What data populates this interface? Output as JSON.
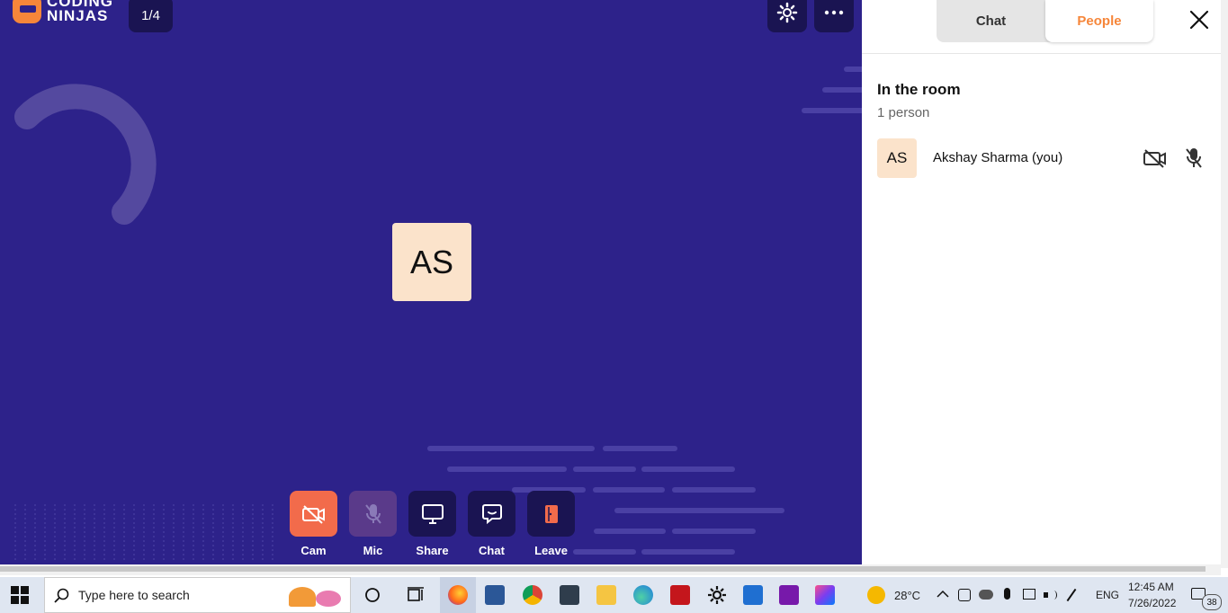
{
  "app": {
    "logo_text_line1": "CODING",
    "logo_text_line2": "NINJAS",
    "page_counter": "1/4"
  },
  "stage": {
    "avatar_initials": "AS"
  },
  "controls": [
    {
      "label": "Cam",
      "icon": "camera-off-icon",
      "color": "#f26b4b"
    },
    {
      "label": "Mic",
      "icon": "mic-off-icon",
      "color": "#5a3a8a"
    },
    {
      "label": "Share",
      "icon": "screen-share-icon",
      "color": "#1a1452"
    },
    {
      "label": "Chat",
      "icon": "chat-icon",
      "color": "#1a1452"
    },
    {
      "label": "Leave",
      "icon": "leave-door-icon",
      "color": "#1a1452"
    }
  ],
  "panel": {
    "tabs": [
      "Chat",
      "People"
    ],
    "active_tab": "People",
    "section_title": "In the room",
    "count_text": "1 person",
    "participants": [
      {
        "initials": "AS",
        "name": "Akshay Sharma (you)",
        "camera": "off",
        "mic": "off"
      }
    ]
  },
  "taskbar": {
    "search_placeholder": "Type here to search",
    "weather": "28°C",
    "language": "ENG",
    "time": "12:45 AM",
    "date": "7/26/2022",
    "notification_count": "38"
  },
  "colors": {
    "stage_bg": "#2d228a",
    "accent": "#f6863a",
    "dark_button": "#1a1452"
  }
}
